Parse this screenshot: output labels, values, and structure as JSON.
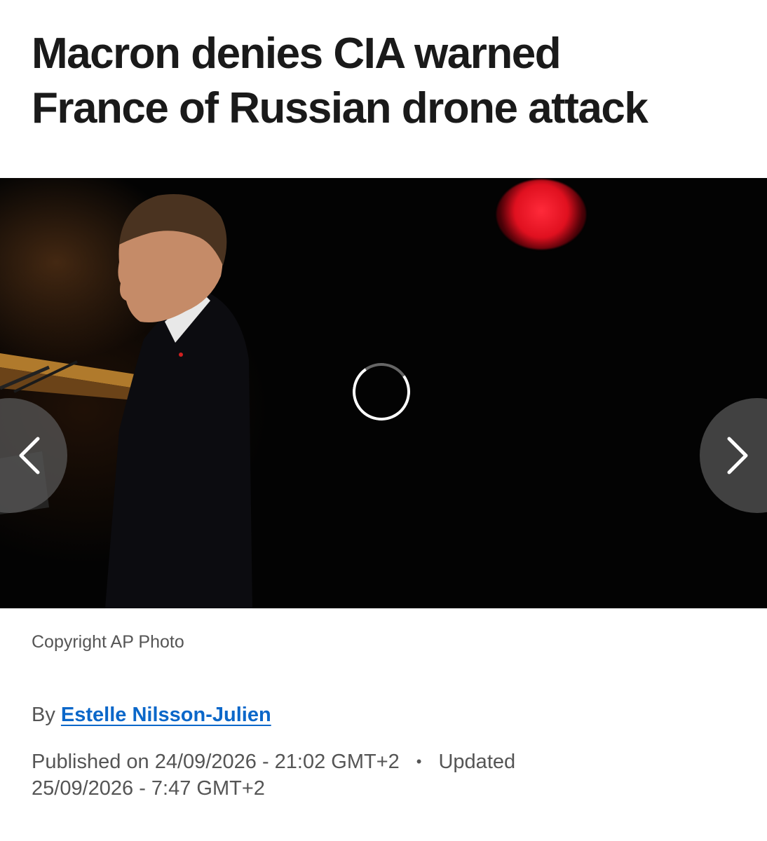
{
  "article": {
    "headline_line1": "Macron denies CIA warned",
    "headline_line2": "France of Russian drone attack"
  },
  "media": {
    "prev_icon": "chevron-left-icon",
    "next_icon": "chevron-right-icon",
    "loading_icon": "loading-spinner-icon",
    "accent_red": "#e0101f",
    "caption": "Copyright AP Photo"
  },
  "byline": {
    "prefix": "By",
    "author": "Estelle Nilsson-Julien",
    "author_color": "#0b67c9"
  },
  "dates": {
    "published": "Published on 24/09/2026 - 21:02 GMT+2",
    "separator": "•",
    "updated_label": "Updated",
    "updated": "25/09/2026 - 7:47 GMT+2"
  }
}
